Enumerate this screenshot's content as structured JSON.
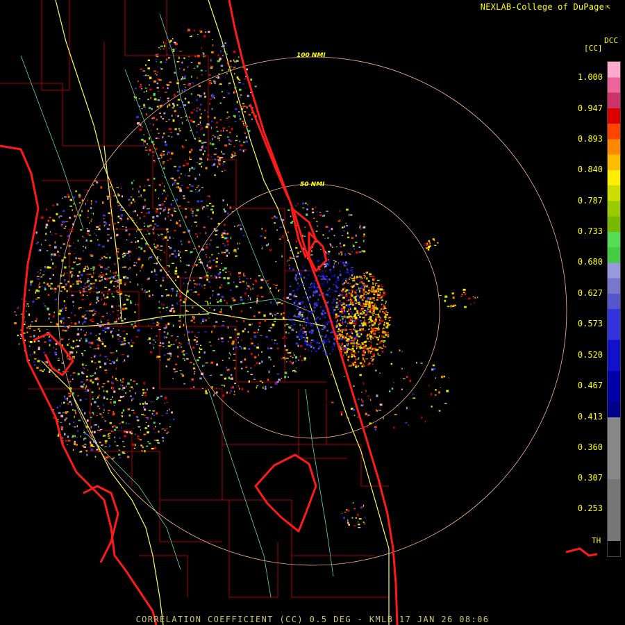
{
  "header": {
    "brand": "NEXLAB-College of DuPage",
    "brand_icon": "cursor-icon"
  },
  "radar": {
    "site": "KMLB",
    "range_rings": [
      {
        "label": "50 NMI",
        "nmi": 50
      },
      {
        "label": "100 NMI",
        "nmi": 100
      }
    ]
  },
  "legend": {
    "product": "DCC",
    "unit": "[CC]",
    "ticks": [
      "1.000",
      "0.947",
      "0.893",
      "0.840",
      "0.787",
      "0.733",
      "0.680",
      "0.627",
      "0.573",
      "0.520",
      "0.467",
      "0.413",
      "0.360",
      "0.307",
      "0.253"
    ],
    "threshold_label": "TH",
    "colors": [
      "#ffaacc",
      "#ee6699",
      "#cc3366",
      "#dd0000",
      "#ff4400",
      "#ff8800",
      "#ffbb00",
      "#ffee00",
      "#ccdd00",
      "#99cc00",
      "#77bb00",
      "#55dd55",
      "#44cc44",
      "#9999dd",
      "#7777cc",
      "#5555cc",
      "#3333dd",
      "#1111cc",
      "#0000aa",
      "#000088",
      "#888888",
      "#777777",
      "#000000"
    ]
  },
  "footer": {
    "caption": "CORRELATION COEFFICIENT (CC) 0.5 DEG - KMLB 17 JAN 26 08:06"
  },
  "colors": {
    "background": "#000000",
    "coastline": "#ff1a1a",
    "county_lines": "#aa0000",
    "highways": "#ffff66",
    "roads": "#66ddaa",
    "range_rings": "#ffbb99",
    "text": "#ffff00"
  }
}
